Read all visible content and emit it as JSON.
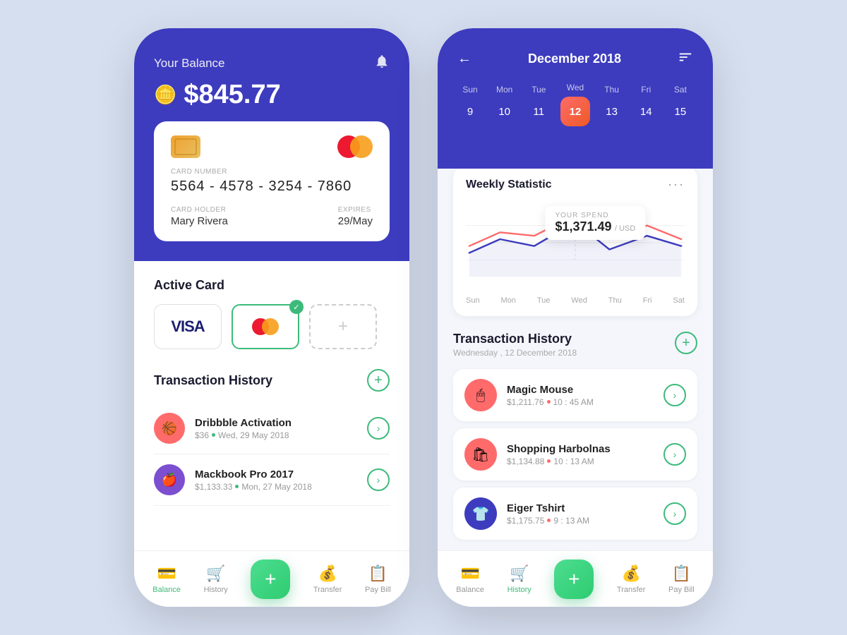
{
  "left_phone": {
    "balance_label": "Your Balance",
    "balance_amount": "$845.77",
    "card": {
      "number_label": "CARD NUMBER",
      "number": "5564  -  4578  -  3254  -  7860",
      "holder_label": "CARD HOLDER",
      "holder": "Mary Rivera",
      "expires_label": "EXPIRES",
      "expires": "29/May"
    },
    "active_card_label": "Active Card",
    "transaction_history_label": "Transaction History",
    "transactions": [
      {
        "name": "Dribbble Activation",
        "amount": "$36",
        "date": "Wed, 29 May 2018",
        "icon_color": "#ff6b6b",
        "icon_emoji": "🏀"
      },
      {
        "name": "Mackbook Pro 2017",
        "amount": "$1,133.33",
        "date": "Mon, 27 May 2018",
        "icon_color": "#7b4fd0",
        "icon_emoji": "🍎"
      }
    ],
    "nav": {
      "items": [
        {
          "label": "Balance",
          "icon": "💳",
          "active": true
        },
        {
          "label": "History",
          "icon": "🛒",
          "active": false
        },
        {
          "label": "",
          "icon": "+",
          "center": true
        },
        {
          "label": "Transfer",
          "icon": "💰",
          "active": false
        },
        {
          "label": "Pay Bill",
          "icon": "📋",
          "active": false
        }
      ]
    }
  },
  "right_phone": {
    "header": {
      "back_label": "←",
      "month_title": "December 2018",
      "filter_icon": "⊞"
    },
    "calendar": {
      "days": [
        {
          "name": "Sun",
          "num": "9",
          "active": false
        },
        {
          "name": "Mon",
          "num": "10",
          "active": false
        },
        {
          "name": "Tue",
          "num": "11",
          "active": false
        },
        {
          "name": "Wed",
          "num": "12",
          "active": true
        },
        {
          "name": "Thu",
          "num": "13",
          "active": false
        },
        {
          "name": "Fri",
          "num": "14",
          "active": false
        },
        {
          "name": "Sat",
          "num": "15",
          "active": false
        }
      ]
    },
    "weekly_statistic": {
      "title": "Weekly Statistic",
      "spend_label": "YOUR SPEND",
      "spend_amount": "$1,371.49",
      "spend_currency": "/ USD",
      "chart_labels": [
        "Sun",
        "Mon",
        "Tue",
        "Wed",
        "Thu",
        "Fri",
        "Sat"
      ]
    },
    "transaction_history": {
      "title": "Transaction History",
      "date": "Wednesday , 12 December 2018",
      "transactions": [
        {
          "name": "Magic Mouse",
          "amount": "$1,211.76",
          "time": "10 : 45 AM",
          "icon_color": "#ff6b6b",
          "icon_emoji": "🖱"
        },
        {
          "name": "Shopping Harbolnas",
          "amount": "$1,134.88",
          "time": "10 : 13 AM",
          "icon_color": "#ff6b6b",
          "icon_emoji": "🛍"
        },
        {
          "name": "Eiger Tshirt",
          "amount": "$1,175.75",
          "time": "9 : 13 AM",
          "icon_color": "#3d3cbe",
          "icon_emoji": "👕"
        }
      ]
    },
    "nav": {
      "items": [
        {
          "label": "Balance",
          "icon": "💳",
          "active": false
        },
        {
          "label": "History",
          "icon": "🛒",
          "active": true
        },
        {
          "label": "",
          "icon": "+",
          "center": true
        },
        {
          "label": "Transfer",
          "icon": "💰",
          "active": false
        },
        {
          "label": "Pay Bill",
          "icon": "📋",
          "active": false
        }
      ]
    }
  }
}
